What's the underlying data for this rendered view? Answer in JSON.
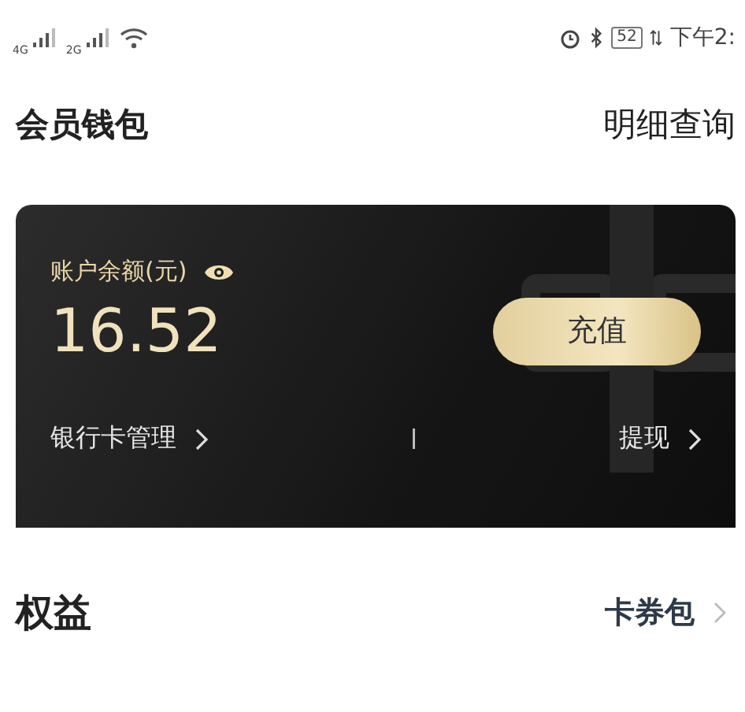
{
  "status_bar": {
    "network_1": "4G",
    "network_2": "2G",
    "battery": "52",
    "time": "下午2:"
  },
  "header": {
    "title": "会员钱包",
    "link": "明细查询"
  },
  "wallet_card": {
    "balance_label": "账户余额(元)",
    "balance": "16.52",
    "recharge_button": "充值",
    "bank_card_link": "银行卡管理",
    "withdraw_link": "提现"
  },
  "benefits": {
    "title": "权益",
    "link": "卡券包"
  }
}
